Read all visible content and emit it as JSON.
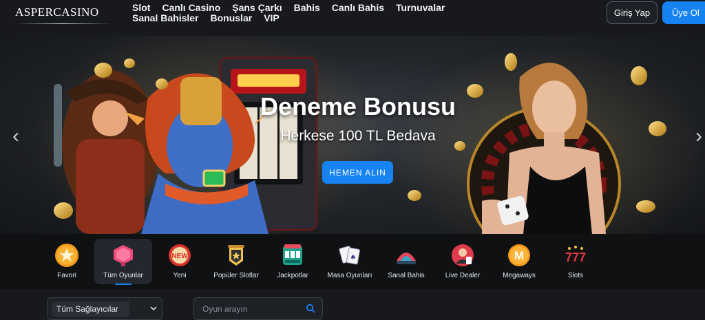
{
  "header": {
    "logo": "ASPERCASINO",
    "nav": [
      "Slot",
      "Canlı Casino",
      "Şans Çarkı",
      "Bahis",
      "Canlı Bahis",
      "Turnuvalar",
      "Sanal Bahisler",
      "Bonuslar",
      "VIP"
    ],
    "login_label": "Giriş Yap",
    "register_label": "Üye Ol"
  },
  "banner": {
    "title": "Deneme Bonusu",
    "subtitle": "Herkese 100 TL Bedava",
    "cta_label": "HEMEN ALIN",
    "prev_icon": "chevron-left-icon",
    "next_icon": "chevron-right-icon"
  },
  "categories": [
    {
      "label": "Favori",
      "icon": "star-icon"
    },
    {
      "label": "Tüm Oyunlar",
      "icon": "all-games-icon",
      "active": true
    },
    {
      "label": "Yeni",
      "icon": "new-badge-icon"
    },
    {
      "label": "Popüler Slotlar",
      "icon": "popular-slots-icon"
    },
    {
      "label": "Jackpotlar",
      "icon": "jackpot-machine-icon"
    },
    {
      "label": "Masa Oyunları",
      "icon": "playing-cards-icon"
    },
    {
      "label": "Sanal Bahis",
      "icon": "virtual-bet-icon"
    },
    {
      "label": "Live Dealer",
      "icon": "live-dealer-icon"
    },
    {
      "label": "Megaways",
      "icon": "megaways-icon"
    },
    {
      "label": "Slots",
      "icon": "slots-777-icon"
    }
  ],
  "filters": {
    "provider_value": "Tüm Sağlayıcılar",
    "search_placeholder": "Oyun arayın"
  },
  "colors": {
    "accent": "#1783f2",
    "background": "#16191d",
    "category_bar": "#0f1113"
  }
}
